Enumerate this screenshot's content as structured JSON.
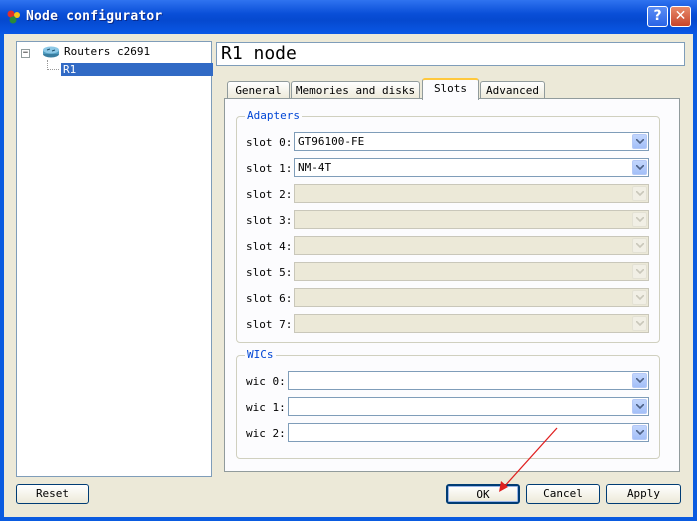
{
  "window": {
    "title": "Node configurator",
    "help_glyph": "?",
    "close_glyph": "✕"
  },
  "tree": {
    "expander_glyph": "−",
    "root_label": "Routers c2691",
    "child_label": "R1",
    "icon": "router-icon"
  },
  "heading": "R1 node",
  "tabs": [
    "General",
    "Memories and disks",
    "Slots",
    "Advanced"
  ],
  "active_tab": "Slots",
  "adapters": {
    "title": "Adapters",
    "slots": [
      {
        "label": "slot 0:",
        "value": "GT96100-FE",
        "enabled": true
      },
      {
        "label": "slot 1:",
        "value": "NM-4T",
        "enabled": true
      },
      {
        "label": "slot 2:",
        "value": "",
        "enabled": false
      },
      {
        "label": "slot 3:",
        "value": "",
        "enabled": false
      },
      {
        "label": "slot 4:",
        "value": "",
        "enabled": false
      },
      {
        "label": "slot 5:",
        "value": "",
        "enabled": false
      },
      {
        "label": "slot 6:",
        "value": "",
        "enabled": false
      },
      {
        "label": "slot 7:",
        "value": "",
        "enabled": false
      }
    ]
  },
  "wics": {
    "title": "WICs",
    "slots": [
      {
        "label": "wic 0:",
        "value": ""
      },
      {
        "label": "wic 1:",
        "value": ""
      },
      {
        "label": "wic 2:",
        "value": ""
      }
    ]
  },
  "buttons": {
    "reset": "Reset",
    "ok": "OK",
    "cancel": "Cancel",
    "apply": "Apply"
  },
  "colors": {
    "titlebar": "#0a4fd8",
    "selection": "#316ac5",
    "group_title": "#0046d5",
    "annotation_arrow": "#e02020"
  }
}
